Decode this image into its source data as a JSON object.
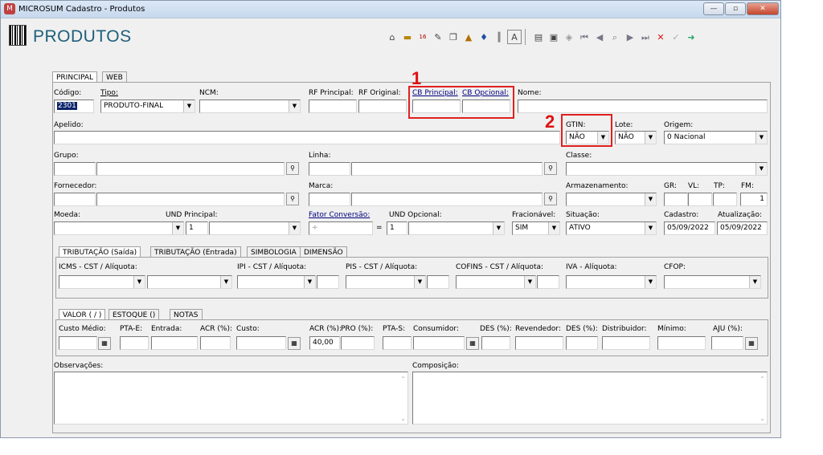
{
  "window": {
    "title": "MICROSUM Cadastro - Produtos",
    "min": "—",
    "max": "▫",
    "close": "✕"
  },
  "header": {
    "title": "PRODUTOS"
  },
  "toolbar": {
    "icons": [
      "open-icon",
      "truck-icon",
      "1690-icon",
      "tools-icon",
      "copy-icon",
      "house-icon",
      "pin-icon",
      "barcode-icon",
      "font-icon",
      "doc-icon",
      "save-icon",
      "restore-icon",
      "first-icon",
      "prev-icon",
      "find-icon",
      "next-icon",
      "last-icon",
      "delete-icon",
      "ok-icon",
      "exit-icon"
    ]
  },
  "main_tabs": [
    "PRINCIPAL",
    "WEB"
  ],
  "annotations": {
    "n1": "1",
    "n2": "2"
  },
  "principal": {
    "codigo": {
      "label": "Código:",
      "value": "2301"
    },
    "tipo": {
      "label": "Tipo:",
      "value": "PRODUTO-FINAL"
    },
    "ncm": {
      "label": "NCM:",
      "value": ""
    },
    "rf_principal": {
      "label": "RF Principal:",
      "value": ""
    },
    "rf_original": {
      "label": "RF Original:",
      "value": ""
    },
    "cb_principal": {
      "label": "CB Principal:",
      "value": ""
    },
    "cb_opcional": {
      "label": "CB Opcional:",
      "value": ""
    },
    "nome": {
      "label": "Nome:",
      "value": ""
    },
    "apelido": {
      "label": "Apelido:",
      "value": ""
    },
    "gtin": {
      "label": "GTIN:",
      "value": "NÃO"
    },
    "lote": {
      "label": "Lote:",
      "value": "NÃO"
    },
    "origem": {
      "label": "Origem:",
      "value": "0 Nacional"
    },
    "grupo": {
      "label": "Grupo:"
    },
    "linha": {
      "label": "Linha:"
    },
    "classe": {
      "label": "Classe:",
      "value": ""
    },
    "fornecedor": {
      "label": "Fornecedor:"
    },
    "marca": {
      "label": "Marca:"
    },
    "armazenamento": {
      "label": "Armazenamento:",
      "value": ""
    },
    "gr": {
      "label": "GR:"
    },
    "vl": {
      "label": "VL:"
    },
    "tp": {
      "label": "TP:"
    },
    "fm": {
      "label": "FM:",
      "value": "1"
    },
    "moeda": {
      "label": "Moeda:",
      "value": ""
    },
    "und_principal": {
      "label": "UND Principal:",
      "value": "1"
    },
    "fator_conversao": {
      "label": "Fator Conversão:",
      "div": "÷",
      "eq": "="
    },
    "und_opcional": {
      "label": "UND Opcional:",
      "value": "1"
    },
    "fracionavel": {
      "label": "Fracionável:",
      "value": "SIM"
    },
    "situacao": {
      "label": "Situação:",
      "value": "ATIVO"
    },
    "cadastro": {
      "label": "Cadastro:",
      "value": "05/09/2022"
    },
    "atualizacao": {
      "label": "Atualização:",
      "value": "05/09/2022"
    }
  },
  "tax_tabs": [
    "TRIBUTAÇÃO (Saída)",
    "TRIBUTAÇÃO (Entrada)",
    "SIMBOLOGIA",
    "DIMENSÃO"
  ],
  "tax": {
    "icms": "ICMS - CST / Alíquota:",
    "ipi": "IPI - CST / Alíquota:",
    "pis": "PIS - CST / Alíquota:",
    "cofins": "COFINS - CST / Alíquota:",
    "iva": "IVA - Alíquota:",
    "cfop": "CFOP:"
  },
  "value_tabs": [
    "VALOR ( / )",
    "ESTOQUE ()",
    "NOTAS"
  ],
  "values": {
    "custo_medio": "Custo Médio:",
    "pta_e": "PTA-E:",
    "entrada": "Entrada:",
    "acr1": "ACR (%):",
    "custo": "Custo:",
    "acr2": "ACR (%):",
    "acr2_value": "40,00",
    "pro": "PRO (%):",
    "pta_s": "PTA-S:",
    "consumidor": "Consumidor:",
    "des1": "DES (%):",
    "revendedor": "Revendedor:",
    "des2": "DES (%):",
    "distribuidor": "Distribuidor:",
    "minimo": "Mínimo:",
    "aju": "AJU (%):"
  },
  "observacoes": {
    "label": "Observações:"
  },
  "composicao": {
    "label": "Composição:"
  }
}
